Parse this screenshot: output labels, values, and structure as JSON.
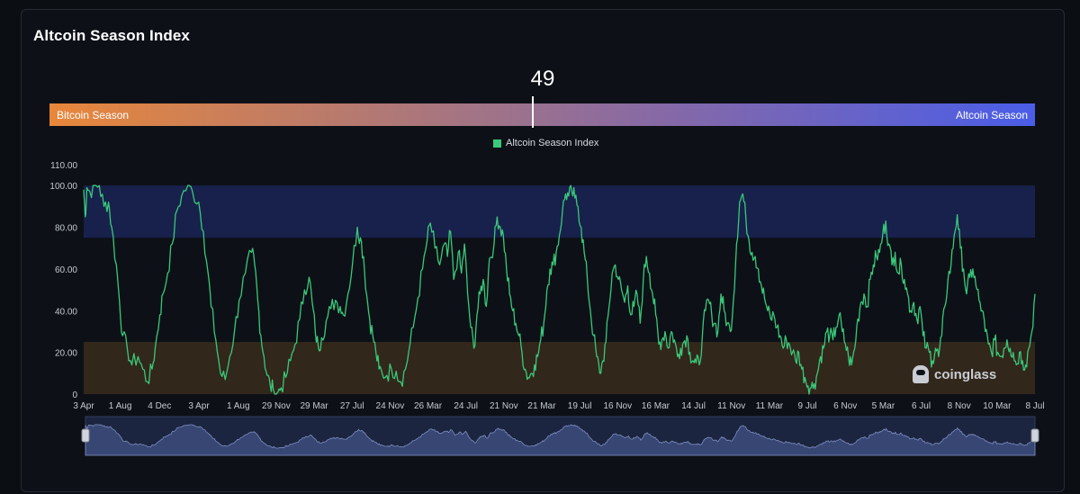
{
  "title": "Altcoin Season Index",
  "gauge": {
    "value": 49,
    "value_label": "49",
    "min_label": "Bitcoin Season",
    "max_label": "Altcoin Season"
  },
  "colors": {
    "series": "#3ac87a",
    "altcoin_band": "#1a2451",
    "bitcoin_band": "#3a2c1c",
    "gauge_start": "#e8873a",
    "gauge_end": "#4a5de8"
  },
  "watermark": "coinglass",
  "chart_data": {
    "type": "line",
    "legend": "top-center",
    "series": [
      {
        "name": "Altcoin Season Index",
        "anchors": [
          [
            0,
            98
          ],
          [
            1,
            85
          ],
          [
            2,
            99
          ],
          [
            4,
            97
          ],
          [
            7,
            100
          ],
          [
            10,
            100
          ],
          [
            13,
            90
          ],
          [
            16,
            92
          ],
          [
            18,
            80
          ],
          [
            21,
            62
          ],
          [
            23,
            45
          ],
          [
            25,
            28
          ],
          [
            28,
            22
          ],
          [
            31,
            14
          ],
          [
            35,
            18
          ],
          [
            38,
            12
          ],
          [
            41,
            6
          ],
          [
            44,
            12
          ],
          [
            46,
            22
          ],
          [
            49,
            38
          ],
          [
            51,
            48
          ],
          [
            54,
            58
          ],
          [
            57,
            72
          ],
          [
            60,
            88
          ],
          [
            63,
            95
          ],
          [
            67,
            100
          ],
          [
            70,
            97
          ],
          [
            74,
            92
          ],
          [
            77,
            78
          ],
          [
            80,
            58
          ],
          [
            82,
            42
          ],
          [
            85,
            26
          ],
          [
            88,
            10
          ],
          [
            91,
            7
          ],
          [
            94,
            18
          ],
          [
            97,
            30
          ],
          [
            100,
            45
          ],
          [
            104,
            58
          ],
          [
            108,
            68
          ],
          [
            110,
            62
          ],
          [
            112,
            45
          ],
          [
            114,
            28
          ],
          [
            116,
            18
          ],
          [
            118,
            9
          ],
          [
            120,
            4
          ],
          [
            122,
            2
          ],
          [
            125,
            1
          ],
          [
            127,
            3
          ],
          [
            130,
            8
          ],
          [
            133,
            16
          ],
          [
            136,
            24
          ],
          [
            139,
            36
          ],
          [
            142,
            50
          ],
          [
            145,
            56
          ],
          [
            147,
            44
          ],
          [
            149,
            30
          ],
          [
            151,
            22
          ],
          [
            153,
            27
          ],
          [
            156,
            35
          ],
          [
            159,
            41
          ],
          [
            162,
            45
          ],
          [
            165,
            42
          ],
          [
            167,
            38
          ],
          [
            170,
            48
          ],
          [
            173,
            63
          ],
          [
            176,
            80
          ],
          [
            178,
            75
          ],
          [
            180,
            66
          ],
          [
            182,
            48
          ],
          [
            184,
            36
          ],
          [
            186,
            28
          ],
          [
            188,
            20
          ],
          [
            190,
            12
          ],
          [
            192,
            10
          ],
          [
            195,
            9
          ],
          [
            198,
            12
          ],
          [
            201,
            11
          ],
          [
            204,
            6
          ],
          [
            207,
            12
          ],
          [
            209,
            20
          ],
          [
            212,
            32
          ],
          [
            215,
            46
          ],
          [
            218,
            60
          ],
          [
            221,
            74
          ],
          [
            223,
            82
          ],
          [
            226,
            70
          ],
          [
            229,
            62
          ],
          [
            232,
            72
          ],
          [
            234,
            66
          ],
          [
            236,
            78
          ],
          [
            238,
            55
          ],
          [
            241,
            68
          ],
          [
            243,
            58
          ],
          [
            245,
            72
          ],
          [
            247,
            48
          ],
          [
            249,
            32
          ],
          [
            251,
            22
          ],
          [
            253,
            38
          ],
          [
            255,
            48
          ],
          [
            257,
            55
          ],
          [
            259,
            42
          ],
          [
            261,
            65
          ],
          [
            264,
            72
          ],
          [
            266,
            85
          ],
          [
            268,
            80
          ],
          [
            270,
            76
          ],
          [
            272,
            60
          ],
          [
            274,
            48
          ],
          [
            276,
            40
          ],
          [
            278,
            34
          ],
          [
            280,
            28
          ],
          [
            282,
            20
          ],
          [
            284,
            12
          ],
          [
            286,
            8
          ],
          [
            288,
            10
          ],
          [
            290,
            14
          ],
          [
            292,
            18
          ],
          [
            294,
            26
          ],
          [
            296,
            34
          ],
          [
            298,
            50
          ],
          [
            300,
            60
          ],
          [
            302,
            62
          ],
          [
            304,
            68
          ],
          [
            306,
            76
          ],
          [
            308,
            88
          ],
          [
            310,
            96
          ],
          [
            312,
            95
          ],
          [
            314,
            97
          ],
          [
            316,
            94
          ],
          [
            318,
            90
          ],
          [
            320,
            80
          ],
          [
            322,
            68
          ],
          [
            324,
            55
          ],
          [
            326,
            40
          ],
          [
            328,
            28
          ],
          [
            330,
            18
          ],
          [
            332,
            10
          ],
          [
            334,
            16
          ],
          [
            336,
            25
          ],
          [
            338,
            42
          ],
          [
            340,
            58
          ],
          [
            342,
            62
          ],
          [
            344,
            55
          ],
          [
            346,
            50
          ],
          [
            348,
            44
          ],
          [
            350,
            52
          ],
          [
            352,
            38
          ],
          [
            354,
            42
          ],
          [
            356,
            48
          ],
          [
            358,
            34
          ],
          [
            360,
            55
          ],
          [
            362,
            66
          ],
          [
            364,
            58
          ],
          [
            366,
            48
          ],
          [
            368,
            38
          ],
          [
            370,
            24
          ],
          [
            372,
            26
          ],
          [
            374,
            30
          ],
          [
            376,
            22
          ],
          [
            378,
            30
          ],
          [
            380,
            26
          ],
          [
            382,
            18
          ],
          [
            384,
            22
          ],
          [
            386,
            25
          ],
          [
            388,
            28
          ],
          [
            390,
            20
          ],
          [
            392,
            16
          ],
          [
            394,
            15
          ],
          [
            396,
            14
          ],
          [
            398,
            28
          ],
          [
            400,
            40
          ],
          [
            402,
            45
          ],
          [
            404,
            38
          ],
          [
            406,
            34
          ],
          [
            408,
            30
          ],
          [
            410,
            48
          ],
          [
            412,
            40
          ],
          [
            414,
            34
          ],
          [
            416,
            30
          ],
          [
            418,
            45
          ],
          [
            420,
            72
          ],
          [
            422,
            92
          ],
          [
            424,
            96
          ],
          [
            426,
            84
          ],
          [
            428,
            74
          ],
          [
            430,
            68
          ],
          [
            432,
            66
          ],
          [
            434,
            60
          ],
          [
            436,
            52
          ],
          [
            438,
            46
          ],
          [
            440,
            40
          ],
          [
            442,
            36
          ],
          [
            444,
            38
          ],
          [
            446,
            32
          ],
          [
            448,
            28
          ],
          [
            450,
            22
          ],
          [
            452,
            26
          ],
          [
            454,
            24
          ],
          [
            456,
            20
          ],
          [
            458,
            16
          ],
          [
            460,
            20
          ],
          [
            462,
            12
          ],
          [
            464,
            8
          ],
          [
            466,
            4
          ],
          [
            468,
            3
          ],
          [
            470,
            5
          ],
          [
            472,
            10
          ],
          [
            474,
            18
          ],
          [
            476,
            22
          ],
          [
            478,
            30
          ],
          [
            480,
            28
          ],
          [
            482,
            26
          ],
          [
            484,
            32
          ],
          [
            486,
            38
          ],
          [
            488,
            30
          ],
          [
            490,
            24
          ],
          [
            492,
            18
          ],
          [
            494,
            14
          ],
          [
            496,
            22
          ],
          [
            498,
            36
          ],
          [
            500,
            44
          ],
          [
            502,
            48
          ],
          [
            504,
            42
          ],
          [
            506,
            55
          ],
          [
            508,
            62
          ],
          [
            510,
            66
          ],
          [
            512,
            68
          ],
          [
            514,
            76
          ],
          [
            516,
            83
          ],
          [
            518,
            72
          ],
          [
            520,
            62
          ],
          [
            522,
            68
          ],
          [
            524,
            58
          ],
          [
            526,
            62
          ],
          [
            528,
            55
          ],
          [
            530,
            48
          ],
          [
            532,
            40
          ],
          [
            534,
            44
          ],
          [
            536,
            36
          ],
          [
            538,
            42
          ],
          [
            540,
            28
          ],
          [
            542,
            22
          ],
          [
            544,
            20
          ],
          [
            546,
            16
          ],
          [
            548,
            22
          ],
          [
            550,
            18
          ],
          [
            552,
            28
          ],
          [
            554,
            42
          ],
          [
            556,
            55
          ],
          [
            558,
            62
          ],
          [
            560,
            76
          ],
          [
            562,
            86
          ],
          [
            564,
            70
          ],
          [
            566,
            60
          ],
          [
            568,
            48
          ],
          [
            570,
            56
          ],
          [
            572,
            60
          ],
          [
            574,
            52
          ],
          [
            576,
            45
          ],
          [
            578,
            40
          ],
          [
            580,
            30
          ],
          [
            582,
            24
          ],
          [
            584,
            20
          ],
          [
            586,
            26
          ],
          [
            588,
            20
          ],
          [
            590,
            18
          ],
          [
            592,
            22
          ],
          [
            594,
            26
          ],
          [
            596,
            22
          ],
          [
            598,
            20
          ],
          [
            600,
            14
          ],
          [
            602,
            20
          ],
          [
            604,
            16
          ],
          [
            606,
            14
          ],
          [
            608,
            22
          ],
          [
            610,
            30
          ],
          [
            612,
            48
          ]
        ]
      }
    ],
    "x_total_days": 612,
    "x_ticks": [
      {
        "label": "3 Apr",
        "day": 0
      },
      {
        "label": "1 Aug",
        "day": 26
      },
      {
        "label": "4 Dec",
        "day": 54
      },
      {
        "label": "3 Apr",
        "day": 82
      },
      {
        "label": "1 Aug",
        "day": 110
      },
      {
        "label": "29 Nov",
        "day": 137
      },
      {
        "label": "29 Mar",
        "day": 164
      },
      {
        "label": "27 Jul",
        "day": 191
      },
      {
        "label": "24 Nov",
        "day": 218
      },
      {
        "label": "26 Mar",
        "day": 245
      },
      {
        "label": "24 Jul",
        "day": 272
      },
      {
        "label": "21 Nov",
        "day": 299
      },
      {
        "label": "21 Mar",
        "day": 326
      },
      {
        "label": "19 Jul",
        "day": 353
      },
      {
        "label": "16 Nov",
        "day": 380
      },
      {
        "label": "16 Mar",
        "day": 407
      },
      {
        "label": "14 Jul",
        "day": 434
      },
      {
        "label": "11 Nov",
        "day": 461
      },
      {
        "label": "11 Mar",
        "day": 488
      },
      {
        "label": "9 Jul",
        "day": 515
      },
      {
        "label": "6 Nov",
        "day": 542
      },
      {
        "label": "5 Mar",
        "day": 569
      },
      {
        "label": "6 Jul",
        "day": 596
      },
      {
        "label": "8 Nov",
        "day": 623
      },
      {
        "label": "10 Mar",
        "day": 650
      },
      {
        "label": "8 Jul",
        "day": 677
      }
    ],
    "y_ticks": [
      "0",
      "20.00",
      "40.00",
      "60.00",
      "80.00",
      "100.00",
      "110.00"
    ],
    "y_tick_values": [
      0,
      20,
      40,
      60,
      80,
      100,
      110
    ],
    "ylim": [
      0,
      110
    ],
    "bands": [
      {
        "name": "Altcoin Season",
        "from": 75,
        "to": 100
      },
      {
        "name": "Bitcoin Season",
        "from": 0,
        "to": 25
      }
    ]
  }
}
